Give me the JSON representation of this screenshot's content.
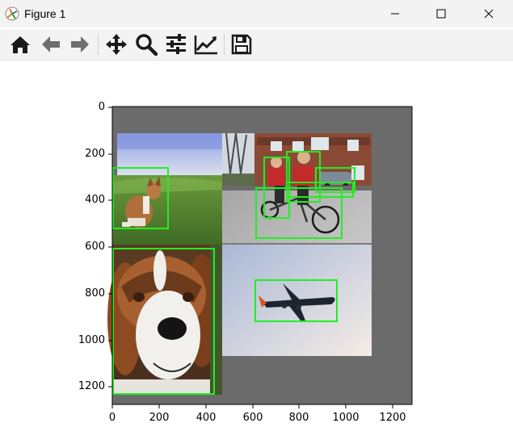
{
  "window": {
    "title": "Figure 1",
    "controls": {
      "minimize": "minimize",
      "maximize": "maximize",
      "close": "close"
    }
  },
  "toolbar": {
    "items": [
      {
        "name": "home-icon",
        "tooltip": "Home"
      },
      {
        "name": "back-icon",
        "tooltip": "Back"
      },
      {
        "name": "forward-icon",
        "tooltip": "Forward"
      },
      {
        "name": "pan-icon",
        "tooltip": "Pan"
      },
      {
        "name": "zoom-icon",
        "tooltip": "Zoom"
      },
      {
        "name": "subplots-icon",
        "tooltip": "Configure subplots"
      },
      {
        "name": "edit-axis-icon",
        "tooltip": "Edit axis"
      },
      {
        "name": "save-icon",
        "tooltip": "Save"
      }
    ]
  },
  "plot": {
    "y_ticks": [
      "0",
      "200",
      "400",
      "600",
      "800",
      "1000",
      "1200"
    ],
    "x_ticks": [
      "0",
      "200",
      "400",
      "600",
      "800",
      "1000",
      "1200"
    ],
    "image_size": [
      1280,
      1280
    ],
    "background_color": "#6b6b6b",
    "box_color": "#22ee22",
    "panels": [
      {
        "name": "dog-field-image",
        "subject": "dog on grass"
      },
      {
        "name": "cyclists-image",
        "subject": "two cyclists on a tandem"
      },
      {
        "name": "saint-bernard-image",
        "subject": "saint bernard dog face"
      },
      {
        "name": "airplane-image",
        "subject": "airplane in sky"
      }
    ]
  }
}
